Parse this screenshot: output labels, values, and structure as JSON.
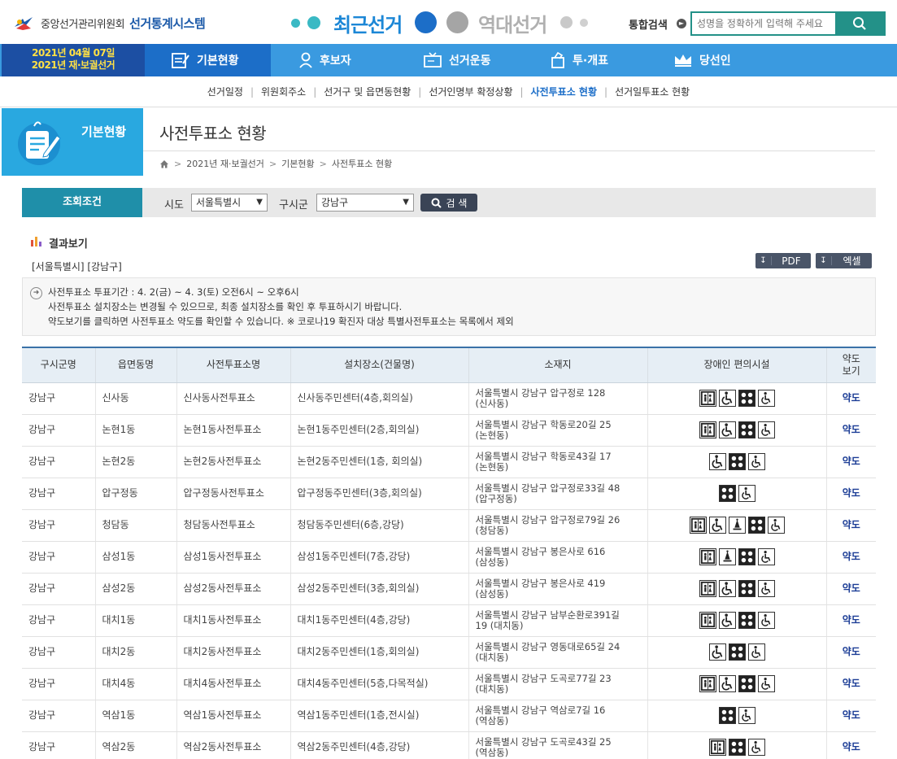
{
  "header": {
    "org_name": "중앙선거관리위원회",
    "system_name": "선거통계시스템",
    "era_recent": "최근선거",
    "era_past": "역대선거",
    "search_label": "통합검색",
    "search_placeholder": "성명을 정확하게 입력해 주세요",
    "colors": {
      "accent": "#239188",
      "brand_blue": "#1c5aa9",
      "recent": "#1c87d6"
    }
  },
  "nav": {
    "date_line1": "2021년 04월 07일",
    "date_line2": "2021년 재·보궐선거",
    "items": [
      {
        "label": "기본현황",
        "icon": "clipboard-icon"
      },
      {
        "label": "후보자",
        "icon": "person-icon"
      },
      {
        "label": "선거운동",
        "icon": "tv-icon"
      },
      {
        "label": "투·개표",
        "icon": "ballot-icon"
      },
      {
        "label": "당선인",
        "icon": "crown-icon"
      }
    ]
  },
  "subnav": [
    "선거일정",
    "위원회주소",
    "선거구 및 읍면동현황",
    "선거인명부 확정상황",
    "사전투표소 현황",
    "선거일투표소 현황"
  ],
  "section": {
    "label": "기본현황",
    "title": "사전투표소 현황"
  },
  "breadcrumb": [
    "2021년 재·보궐선거",
    "기본현황",
    "사전투표소 현황"
  ],
  "condition": {
    "label": "조회조건",
    "sido_label": "시도",
    "sido_value": "서울특별시",
    "gu_label": "구시군",
    "gu_value": "강남구",
    "search_button": "검 색"
  },
  "results": {
    "title": "결과보기",
    "subtitle": "[서울특별시] [강남구]",
    "pdf_button": "PDF",
    "excel_button": "엑셀"
  },
  "notice": {
    "line1": "사전투표소 투표기간 : 4. 2(금) ~ 4. 3(토) 오전6시 ~ 오후6시",
    "line2": "사전투표소 설치장소는 변경될 수 있으므로, 최종 설치장소를 확인 후 투표하시기 바랍니다.",
    "line3": "약도보기를 클릭하면 사전투표소 약도를 확인할 수 있습니다. ※ 코로나19 확진자 대상 특별사전투표소는 목록에서 제외"
  },
  "table": {
    "headers": [
      "구시군명",
      "읍면동명",
      "사전투표소명",
      "설치장소(건물명)",
      "소재지",
      "장애인 편의시설",
      "약도\n보기"
    ],
    "rows": [
      {
        "gu": "강남구",
        "dong": "신사동",
        "name": "신사동사전투표소",
        "place": "신사동주민센터(4층,회의실)",
        "addr1": "서울특별시 강남구 압구정로 128",
        "addr2": "(신사동)",
        "fac": [
          "elevator",
          "wheelchair",
          "braille",
          "ramp"
        ],
        "map": "약도"
      },
      {
        "gu": "강남구",
        "dong": "논현1동",
        "name": "논현1동사전투표소",
        "place": "논현1동주민센터(2층,회의실)",
        "addr1": "서울특별시 강남구 학동로20길 25",
        "addr2": "(논현동)",
        "fac": [
          "elevator",
          "wheelchair",
          "braille",
          "ramp"
        ],
        "map": "약도"
      },
      {
        "gu": "강남구",
        "dong": "논현2동",
        "name": "논현2동사전투표소",
        "place": "논현2동주민센터(1층, 회의실)",
        "addr1": "서울특별시 강남구 학동로43길 17",
        "addr2": "(논현동)",
        "fac": [
          "wheelchair",
          "braille",
          "ramp"
        ],
        "map": "약도"
      },
      {
        "gu": "강남구",
        "dong": "압구정동",
        "name": "압구정동사전투표소",
        "place": "압구정동주민센터(3층,회의실)",
        "addr1": "서울특별시 강남구 압구정로33길 48",
        "addr2": "(압구정동)",
        "fac": [
          "braille",
          "ramp"
        ],
        "map": "약도"
      },
      {
        "gu": "강남구",
        "dong": "청담동",
        "name": "청담동사전투표소",
        "place": "청담동주민센터(6층,강당)",
        "addr1": "서울특별시 강남구 압구정로79길 26",
        "addr2": "(청담동)",
        "fac": [
          "elevator",
          "wheelchair",
          "bell",
          "braille",
          "ramp"
        ],
        "map": "약도"
      },
      {
        "gu": "강남구",
        "dong": "삼성1동",
        "name": "삼성1동사전투표소",
        "place": "삼성1동주민센터(7층,강당)",
        "addr1": "서울특별시 강남구 봉은사로 616",
        "addr2": "(삼성동)",
        "fac": [
          "elevator",
          "bell",
          "braille",
          "ramp"
        ],
        "map": "약도"
      },
      {
        "gu": "강남구",
        "dong": "삼성2동",
        "name": "삼성2동사전투표소",
        "place": "삼성2동주민센터(3층,회의실)",
        "addr1": "서울특별시 강남구 봉은사로 419",
        "addr2": "(삼성동)",
        "fac": [
          "elevator",
          "wheelchair",
          "braille",
          "ramp"
        ],
        "map": "약도"
      },
      {
        "gu": "강남구",
        "dong": "대치1동",
        "name": "대치1동사전투표소",
        "place": "대치1동주민센터(4층,강당)",
        "addr1": "서울특별시 강남구 남부순환로391길",
        "addr2": "19 (대치동)",
        "fac": [
          "elevator",
          "wheelchair",
          "braille",
          "ramp"
        ],
        "map": "약도"
      },
      {
        "gu": "강남구",
        "dong": "대치2동",
        "name": "대치2동사전투표소",
        "place": "대치2동주민센터(1층,회의실)",
        "addr1": "서울특별시 강남구 영동대로65길 24",
        "addr2": "(대치동)",
        "fac": [
          "wheelchair",
          "braille",
          "ramp"
        ],
        "map": "약도"
      },
      {
        "gu": "강남구",
        "dong": "대치4동",
        "name": "대치4동사전투표소",
        "place": "대치4동주민센터(5층,다목적실)",
        "addr1": "서울특별시 강남구 도곡로77길 23",
        "addr2": "(대치동)",
        "fac": [
          "elevator",
          "wheelchair",
          "braille",
          "ramp"
        ],
        "map": "약도"
      },
      {
        "gu": "강남구",
        "dong": "역삼1동",
        "name": "역삼1동사전투표소",
        "place": "역삼1동주민센터(1층,전시실)",
        "addr1": "서울특별시 강남구 역삼로7길 16",
        "addr2": "(역삼동)",
        "fac": [
          "braille",
          "ramp"
        ],
        "map": "약도"
      },
      {
        "gu": "강남구",
        "dong": "역삼2동",
        "name": "역삼2동사전투표소",
        "place": "역삼2동주민센터(4층,강당)",
        "addr1": "서울특별시 강남구 도곡로43길 25",
        "addr2": "(역삼동)",
        "fac": [
          "elevator",
          "braille",
          "ramp"
        ],
        "map": "약도"
      }
    ]
  }
}
